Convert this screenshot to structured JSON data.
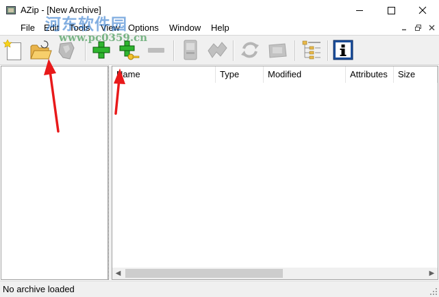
{
  "window": {
    "title": "AZip - [New Archive]",
    "minimize_label": "Minimize",
    "maximize_label": "Maximize",
    "close_label": "Close"
  },
  "watermark": {
    "line1": "河东软件园",
    "line2": "www.pc0359.cn"
  },
  "menu": {
    "items": [
      "File",
      "Edit",
      "Tools",
      "View",
      "Options",
      "Window",
      "Help"
    ]
  },
  "toolbar": {
    "buttons": [
      {
        "name": "new-archive",
        "icon": "new-document-icon"
      },
      {
        "name": "open-archive",
        "icon": "open-folder-icon"
      },
      {
        "name": "extract",
        "icon": "extract-icon"
      },
      {
        "name": "add-files",
        "icon": "plus-icon"
      },
      {
        "name": "add-files-encrypted",
        "icon": "plus-key-icon"
      },
      {
        "name": "delete-entries",
        "icon": "minus-icon"
      },
      {
        "name": "test-archive",
        "icon": "test-icon"
      },
      {
        "name": "find-in-archive",
        "icon": "find-icon"
      },
      {
        "name": "update-archive",
        "icon": "refresh-icon"
      },
      {
        "name": "recompress",
        "icon": "recompress-icon"
      },
      {
        "name": "toggle-tree-view",
        "icon": "tree-view-icon"
      },
      {
        "name": "properties",
        "icon": "info-icon"
      }
    ]
  },
  "list": {
    "columns": [
      "Name",
      "Type",
      "Modified",
      "Attributes",
      "Size"
    ]
  },
  "status": {
    "text": "No archive loaded"
  },
  "colors": {
    "accent_red": "#e8191a",
    "plus_green": "#2fb52f",
    "info_blue": "#1c4f9c"
  }
}
